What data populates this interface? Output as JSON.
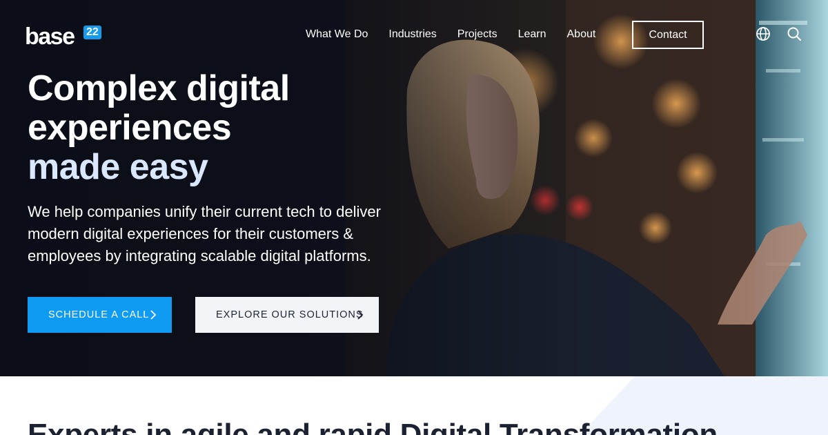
{
  "header": {
    "logo_text": "base",
    "logo_badge": "22",
    "nav": [
      "What We Do",
      "Industries",
      "Projects",
      "Learn",
      "About"
    ],
    "contact_label": "Contact",
    "icons": [
      "globe-icon",
      "search-icon"
    ]
  },
  "hero": {
    "headline_line1": "Complex digital",
    "headline_line2": "experiences",
    "headline_accent": "made easy",
    "subtext": "We help companies unify their current tech to deliver modern digital experiences for their customers & employees by integrating scalable digital platforms.",
    "primary_cta": "SCHEDULE A CALL",
    "secondary_cta": "EXPLORE OUR SOLUTIONS"
  },
  "section": {
    "title": "Experts in agile and rapid Digital Transformation"
  },
  "colors": {
    "accent": "#0f9bf2",
    "headline_accent": "#d9e8ff",
    "dark_bg": "#0f1322",
    "light_button": "#f3f4f8"
  }
}
